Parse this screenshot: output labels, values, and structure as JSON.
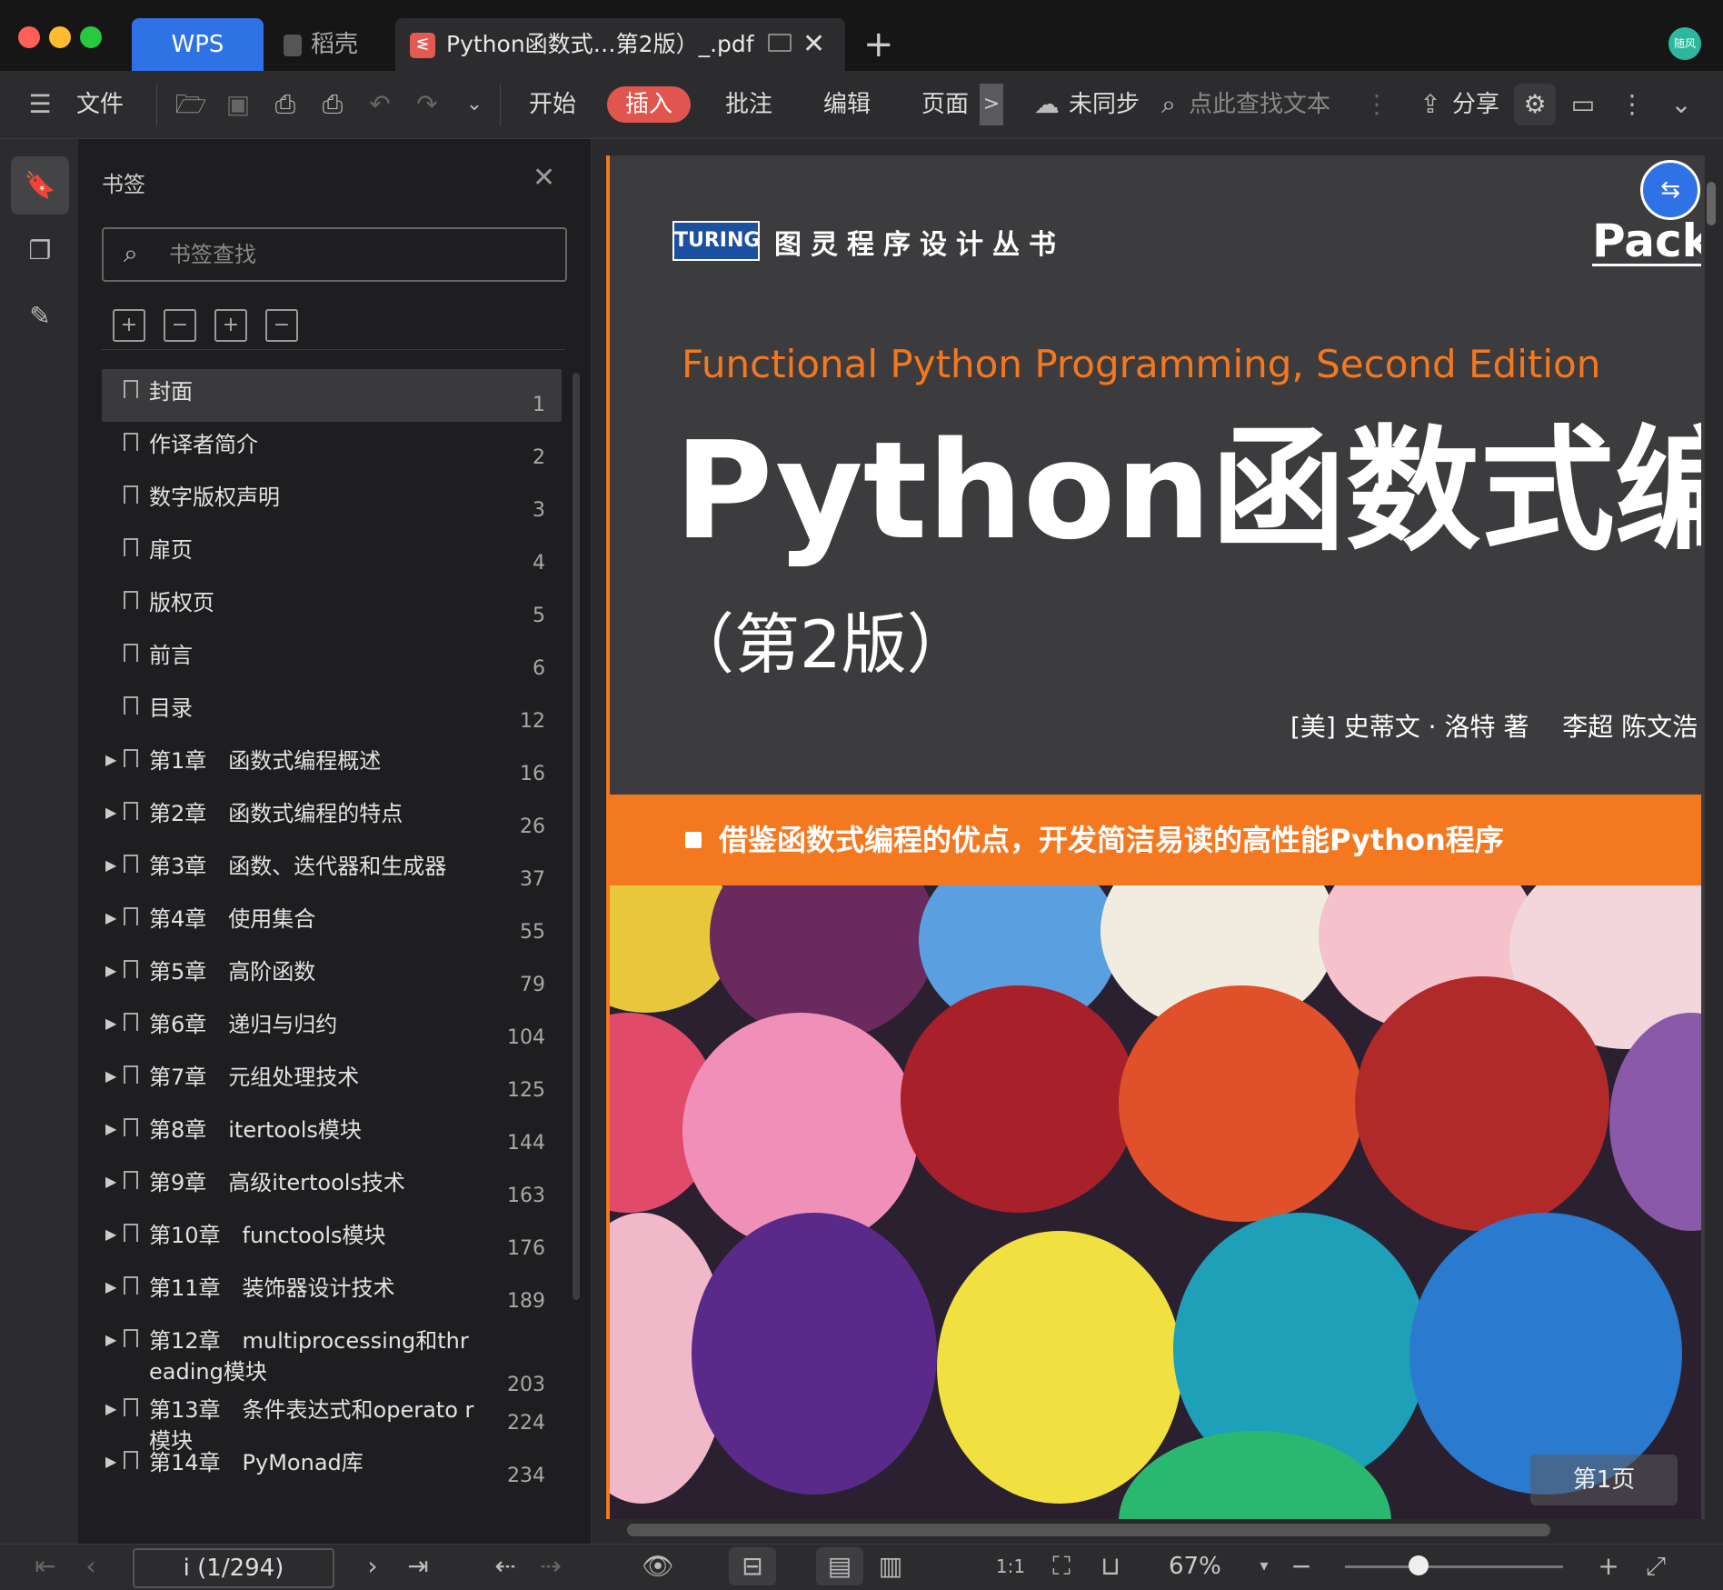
{
  "tabs": {
    "wps": "WPS",
    "daoke": "稻壳",
    "document": "Python函数式…第2版）_.pdf",
    "new_tab": "+",
    "avatar_text": "随风"
  },
  "toolbar": {
    "file": "文件",
    "start": "开始",
    "insert": "插入",
    "annotate": "批注",
    "edit": "编辑",
    "page": "页面",
    "more_arrow": ">",
    "sync": "未同步",
    "find_placeholder": "点此查找文本",
    "share": "分享"
  },
  "panel": {
    "title": "书签",
    "search_placeholder": "书签查找",
    "bookmarks": [
      {
        "label": "封面",
        "page": "1",
        "expandable": false
      },
      {
        "label": "作译者简介",
        "page": "2",
        "expandable": false
      },
      {
        "label": "数字版权声明",
        "page": "3",
        "expandable": false
      },
      {
        "label": "扉页",
        "page": "4",
        "expandable": false
      },
      {
        "label": "版权页",
        "page": "5",
        "expandable": false
      },
      {
        "label": "前言",
        "page": "6",
        "expandable": false
      },
      {
        "label": "目录",
        "page": "12",
        "expandable": false
      },
      {
        "label": "第1章　函数式编程概述",
        "page": "16",
        "expandable": true
      },
      {
        "label": "第2章　函数式编程的特点",
        "page": "26",
        "expandable": true
      },
      {
        "label": "第3章　函数、迭代器和生成器",
        "page": "37",
        "expandable": true
      },
      {
        "label": "第4章　使用集合",
        "page": "55",
        "expandable": true
      },
      {
        "label": "第5章　高阶函数",
        "page": "79",
        "expandable": true
      },
      {
        "label": "第6章　递归与归约",
        "page": "104",
        "expandable": true
      },
      {
        "label": "第7章　元组处理技术",
        "page": "125",
        "expandable": true
      },
      {
        "label": "第8章　itertools模块",
        "page": "144",
        "expandable": true
      },
      {
        "label": "第9章　高级itertools技术",
        "page": "163",
        "expandable": true
      },
      {
        "label": "第10章　functools模块",
        "page": "176",
        "expandable": true
      },
      {
        "label": "第11章　装饰器设计技术",
        "page": "189",
        "expandable": true
      },
      {
        "label": "第12章　multiprocessing和thr eading模块",
        "page": "203",
        "expandable": true
      },
      {
        "label": "第13章　条件表达式和operato r模块",
        "page": "224",
        "expandable": true
      },
      {
        "label": "第14章　PyMonad库",
        "page": "234",
        "expandable": true
      }
    ]
  },
  "cover": {
    "publisher_logo": "TURING",
    "series": "图灵程序设计丛书",
    "brand": "Packt",
    "english_title": "Functional Python Programming, Second Edition",
    "chinese_title": "Python函数式编程",
    "edition": "（第2版）",
    "authors": "[美] 史蒂文 · 洛特  著　 李超  陈文浩",
    "tagline": "借鉴函数式编程的优点，开发简洁易读的高性能Python程序",
    "page_badge": "第1页"
  },
  "statusbar": {
    "page_indicator": "i (1/294)",
    "zoom": "67%"
  },
  "colors": {
    "accent_red": "#e0564f",
    "wps_blue": "#2f72e5",
    "cover_orange": "#f47820"
  }
}
